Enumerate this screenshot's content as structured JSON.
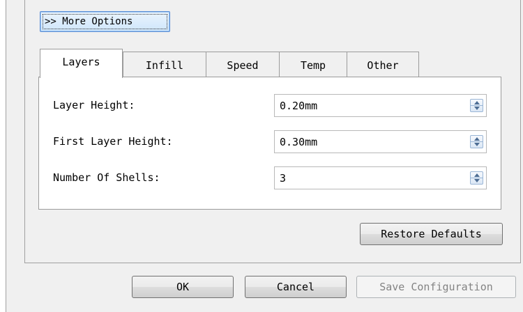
{
  "more_options": {
    "label": ">> More Options"
  },
  "tabs": [
    {
      "label": "Layers",
      "active": true
    },
    {
      "label": "Infill",
      "active": false
    },
    {
      "label": "Speed",
      "active": false
    },
    {
      "label": "Temp",
      "active": false
    },
    {
      "label": "Other",
      "active": false
    }
  ],
  "fields": [
    {
      "label": "Layer Height:",
      "value": "0.20mm"
    },
    {
      "label": "First Layer Height:",
      "value": "0.30mm"
    },
    {
      "label": "Number Of Shells:",
      "value": "3"
    }
  ],
  "restore_defaults": {
    "label": "Restore Defaults"
  },
  "dialog_buttons": {
    "ok": "OK",
    "cancel": "Cancel",
    "save_configuration": "Save Configuration",
    "save_configuration_enabled": false
  },
  "colors": {
    "window_bg": "#f0f0f0",
    "focus_button_border": "#5b8ed6",
    "disabled_text": "#838383"
  }
}
